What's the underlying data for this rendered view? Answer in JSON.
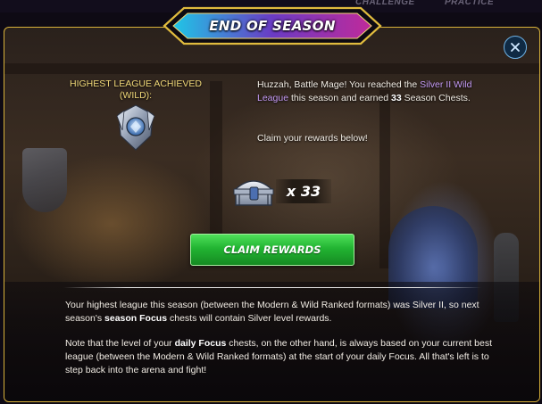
{
  "top_nav": {
    "items": [
      "CHALLENGE",
      "PRACTICE"
    ]
  },
  "modal": {
    "title": "END OF SEASON",
    "close_icon": "close-icon",
    "highest_league": {
      "label": "HIGHEST LEAGUE ACHIEVED (WILD):",
      "badge_icon": "silver-league-badge-icon"
    },
    "intro": {
      "greeting": "Huzzah, Battle Mage! You reached the ",
      "league_name": "Silver II Wild League",
      "mid": " this season and earned ",
      "chest_count": "33",
      "end": " Season Chests."
    },
    "claim_prompt": "Claim your rewards below!",
    "reward": {
      "chest_icon": "season-chest-icon",
      "quantity": "x 33"
    },
    "claim_button": "CLAIM REWARDS",
    "paragraph1": {
      "a": "Your highest league this season (between the Modern & Wild Ranked formats) was Silver II, so next season's ",
      "bold": "season Focus",
      "b": " chests will contain Silver level rewards."
    },
    "paragraph2": {
      "a": "Note that the level of your ",
      "bold": "daily Focus",
      "b": " chests, on the other hand, is always based on your current best league (between the Modern & Wild Ranked formats) at the start of your daily Focus. All that's left is to step back into the arena and fight!"
    }
  },
  "colors": {
    "frame_gold": "#d8b23a",
    "league_label": "#f0d878",
    "league_highlight": "#c49af5",
    "button_green": "#22b432",
    "banner_cyan": "#2fd0e8",
    "banner_magenta": "#c02a9a"
  }
}
